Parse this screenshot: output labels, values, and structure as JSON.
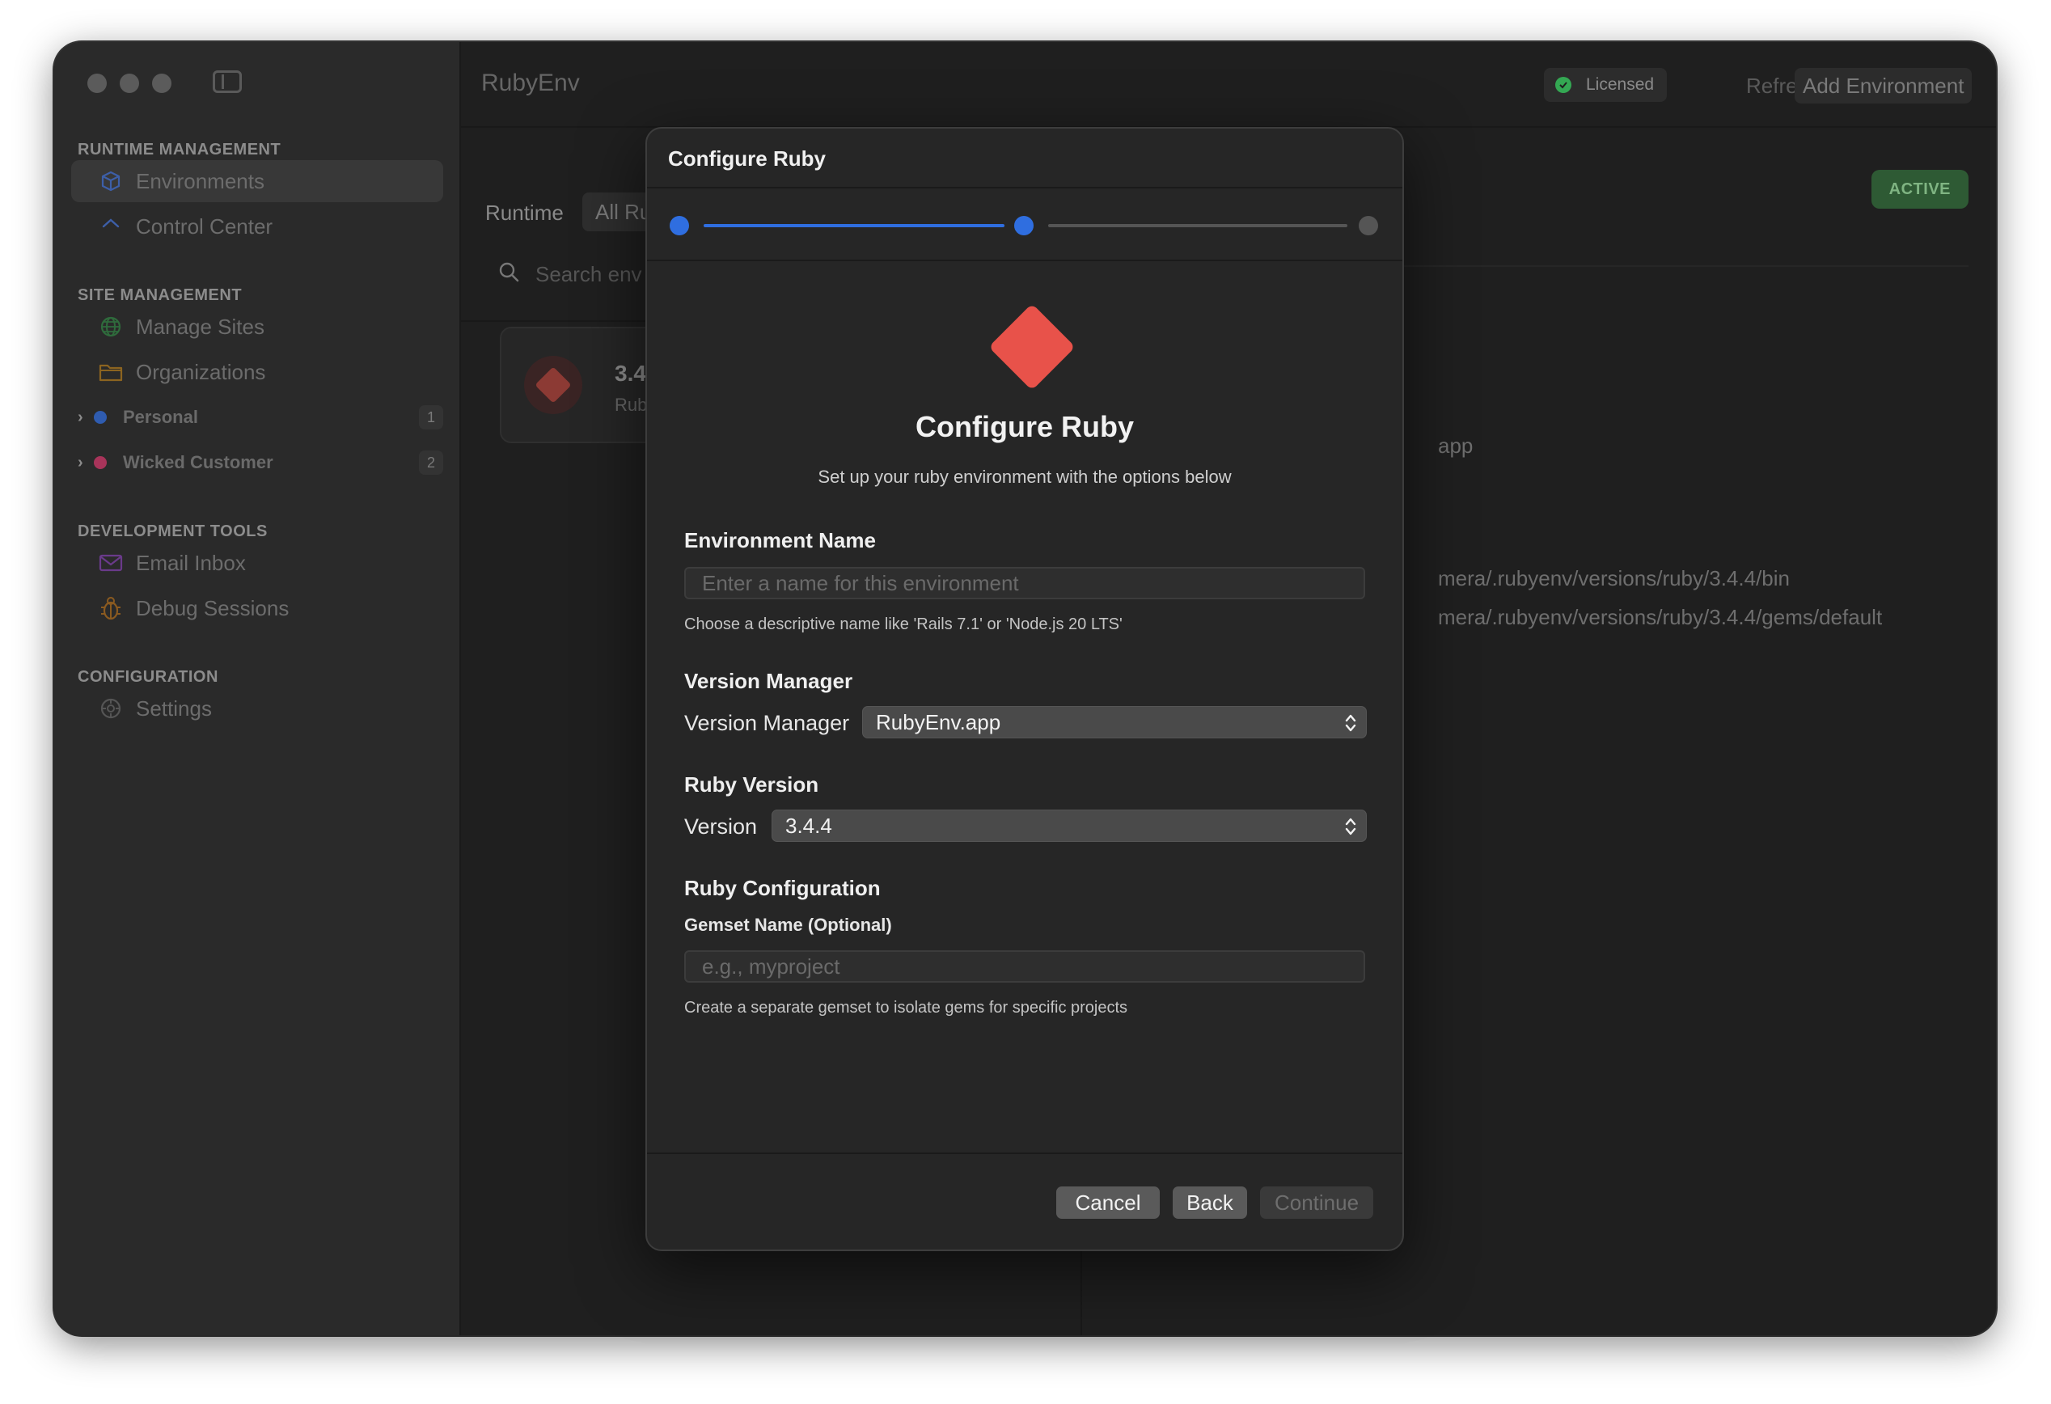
{
  "app": {
    "title": "RubyEnv"
  },
  "toolbar": {
    "licensed": "Licensed",
    "refresh": "Refresh",
    "add_environment": "Add Environment"
  },
  "sidebar": {
    "sections": [
      {
        "title": "RUNTIME MANAGEMENT",
        "items": [
          {
            "label": "Environments",
            "icon": "cube-icon"
          },
          {
            "label": "Control Center",
            "icon": "chevron-up-icon"
          }
        ]
      },
      {
        "title": "SITE MANAGEMENT",
        "items": [
          {
            "label": "Manage Sites",
            "icon": "globe-icon"
          },
          {
            "label": "Organizations",
            "icon": "folder-icon"
          }
        ]
      },
      {
        "title": "DEVELOPMENT TOOLS",
        "items": [
          {
            "label": "Email Inbox",
            "icon": "envelope-icon"
          },
          {
            "label": "Debug Sessions",
            "icon": "bug-icon"
          }
        ]
      },
      {
        "title": "CONFIGURATION",
        "items": [
          {
            "label": "Settings",
            "icon": "gear-icon"
          }
        ]
      }
    ],
    "groups": [
      {
        "label": "Personal",
        "count": "1",
        "color": "#2f6ee0"
      },
      {
        "label": "Wicked Customer",
        "count": "2",
        "color": "#d8426e"
      }
    ]
  },
  "list": {
    "filter_label": "Runtime",
    "filter_value": "All Ru",
    "search_placeholder": "Search env",
    "card": {
      "version": "3.4.",
      "subtitle": "Rub"
    }
  },
  "detail": {
    "badge": "ACTIVE",
    "app_fragment": "app",
    "bin_path": "mera/.rubyenv/versions/ruby/3.4.4/bin",
    "gems_path": "mera/.rubyenv/versions/ruby/3.4.4/gems/default"
  },
  "dialog": {
    "title": "Configure Ruby",
    "steps_completed": 2,
    "steps_total": 3,
    "hero_title": "Configure Ruby",
    "hero_subtitle": "Set up your ruby environment with the options below",
    "env_name": {
      "title": "Environment Name",
      "placeholder": "Enter a name for this environment",
      "value": "",
      "help": "Choose a descriptive name like 'Rails 7.1' or 'Node.js 20 LTS'"
    },
    "version_manager": {
      "title": "Version Manager",
      "label": "Version Manager",
      "value": "RubyEnv.app"
    },
    "ruby_version": {
      "title": "Ruby Version",
      "label": "Version",
      "value": "3.4.4"
    },
    "ruby_config": {
      "title": "Ruby Configuration",
      "gemset_label": "Gemset Name (Optional)",
      "gemset_placeholder": "e.g., myproject",
      "help": "Create a separate gemset to isolate gems for specific projects"
    },
    "buttons": {
      "cancel": "Cancel",
      "back": "Back",
      "continue": "Continue"
    }
  },
  "colors": {
    "accent": "#2f6ee0",
    "ruby": "#e8524a",
    "active_badge": "#2e5a34"
  }
}
